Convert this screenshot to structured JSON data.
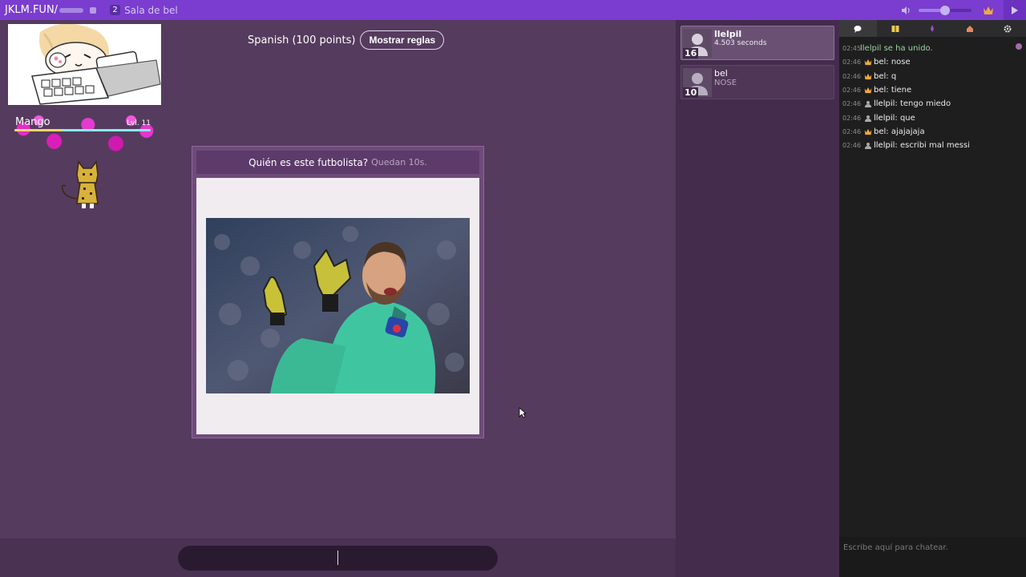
{
  "topbar": {
    "site": "JKLM.FUN/",
    "room_number": "2",
    "room_name": "Sala de bel",
    "volume_level": 0.5
  },
  "profile": {
    "name": "Mango",
    "level": "Lvl. 11",
    "xp_fraction": 0.35
  },
  "game": {
    "language_points": "Spanish (100 points)",
    "rules_button": "Mostrar reglas",
    "question": "Quién es este futbolista?",
    "timer": "Quedan 10s."
  },
  "players": [
    {
      "name": "llelpil",
      "info": "4.503 seconds",
      "score": "16",
      "active": true
    },
    {
      "name": "bel",
      "info": "NOSE",
      "score": "10",
      "active": false
    }
  ],
  "chat": {
    "tabs": [
      "chat-icon",
      "players-icon",
      "rocket-icon",
      "house-icon",
      "settings-icon"
    ],
    "messages": [
      {
        "time": "02:45",
        "type": "system",
        "nick": "",
        "text": "llelpil se ha unido."
      },
      {
        "time": "02:46",
        "type": "crown",
        "nick": "bel",
        "text": ": nose"
      },
      {
        "time": "02:46",
        "type": "crown",
        "nick": "bel",
        "text": ": q"
      },
      {
        "time": "02:46",
        "type": "crown",
        "nick": "bel",
        "text": ": tiene"
      },
      {
        "time": "02:46",
        "type": "user",
        "nick": "llelpil",
        "text": ": tengo miedo"
      },
      {
        "time": "02:46",
        "type": "user",
        "nick": "llelpil",
        "text": ": que"
      },
      {
        "time": "02:46",
        "type": "crown",
        "nick": "bel",
        "text": ": ajajajaja"
      },
      {
        "time": "02:46",
        "type": "user",
        "nick": "llelpil",
        "text": ": escribi mal messi"
      }
    ],
    "placeholder": "Escribe aquí para chatear."
  },
  "answer": {
    "value": ""
  },
  "colors": {
    "topbar": "#7a3dcf",
    "background": "#553b5e",
    "chat_bg": "#1e1e1f",
    "crown": "#f2a93b"
  }
}
